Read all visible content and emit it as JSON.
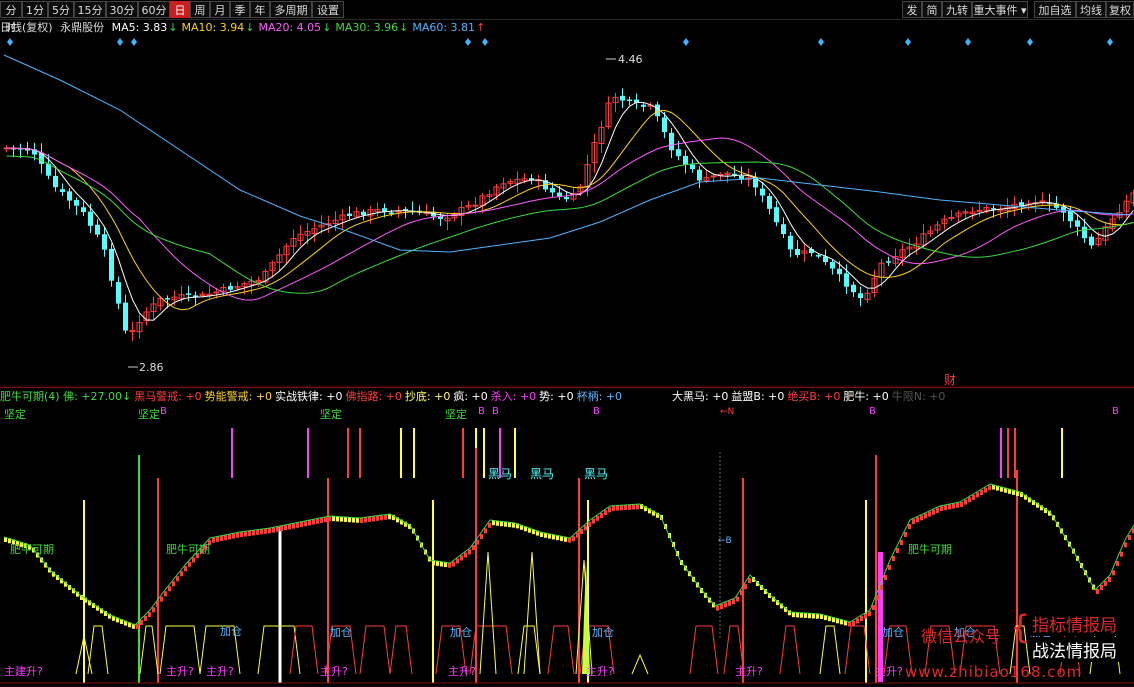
{
  "toolbar": {
    "left": [
      "分时",
      "1分",
      "5分",
      "15分",
      "30分",
      "60分",
      "日",
      "周",
      "月",
      "季",
      "年",
      "多周期",
      "设置"
    ],
    "active": "日",
    "right": [
      "发",
      "简",
      "九转",
      "重大事件",
      "加自选",
      "均线",
      "复权"
    ]
  },
  "info": {
    "period": "日线(复权)",
    "stock": "永鼎股份",
    "ma": [
      {
        "label": "MA5: 3.83",
        "color": "#ffffff"
      },
      {
        "label": "MA10: 3.94",
        "color": "#ffd21e"
      },
      {
        "label": "MA20: 4.05",
        "color": "#ff5aff"
      },
      {
        "label": "MA30: 3.96",
        "color": "#3cdc3c"
      },
      {
        "label": "MA60: 3.81",
        "color": "#50b4ff"
      }
    ]
  },
  "price": {
    "high_label": "4.46",
    "low_label": "2.86",
    "cai_label": "财",
    "colors": {
      "up": "#ff3c3c",
      "down": "#54ffff",
      "ma5": "#ffffff",
      "ma10": "#ffd21e",
      "ma20": "#ff5aff",
      "ma30": "#3cdc3c",
      "ma60": "#50b4ff"
    }
  },
  "indicator": {
    "header_left": [
      {
        "text": "肥牛可期(4) 佛: +27.00↓",
        "color": "#3cdc3c"
      },
      {
        "text": "黑马警戒: +0",
        "color": "#ff3c3c"
      },
      {
        "text": "势能警戒: +0",
        "color": "#ffd21e"
      },
      {
        "text": "实战铁律: +0",
        "color": "#ffffff"
      },
      {
        "text": "佛指路: +0",
        "color": "#ff3c3c"
      },
      {
        "text": "抄底: +0",
        "color": "#ffff66"
      },
      {
        "text": "疯: +0",
        "color": "#ffffff"
      },
      {
        "text": "杀入: +0",
        "color": "#ff3cff"
      },
      {
        "text": "势: +0",
        "color": "#ffffff"
      },
      {
        "text": "杯柄: +0",
        "color": "#5ab4ff"
      }
    ],
    "header_right": [
      {
        "text": "大黑马: +0",
        "color": "#ffffff"
      },
      {
        "text": "益盟B: +0",
        "color": "#ffffff"
      },
      {
        "text": "绝买B: +0",
        "color": "#ff3c3c"
      },
      {
        "text": "肥牛: +0",
        "color": "#ffffff"
      },
      {
        "text": "牛限N: +0",
        "color": "#555555"
      }
    ],
    "jianding": "坚定",
    "b_label": "B",
    "heima": "黑马",
    "feiniu": "肥牛可期",
    "jiacang": "加仓",
    "zhusheng": "主升?",
    "zhujian": "主升?",
    "zhujiansheng": "主建升?",
    "arrow_b": "←B",
    "arrow_n": "←N"
  },
  "watermark": {
    "wechat": "微信公众号",
    "line1": "指标情报局",
    "line2": "战法情报局",
    "site": "www.zhibiao168.com"
  }
}
